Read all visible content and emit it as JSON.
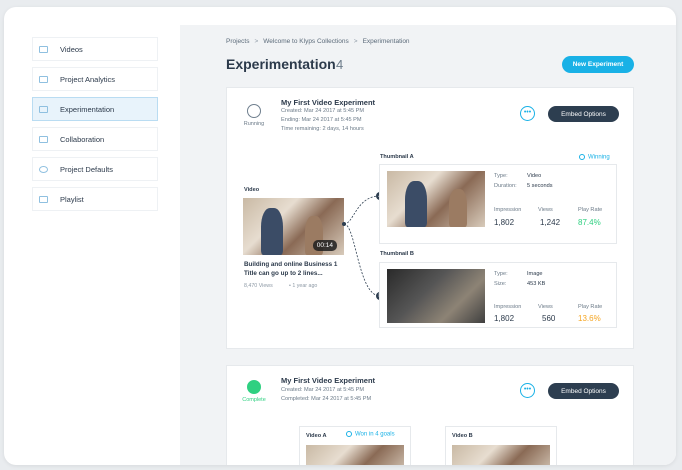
{
  "sidebar": {
    "items": [
      {
        "label": "Videos",
        "icon": "video-icon"
      },
      {
        "label": "Project Analytics",
        "icon": "analytics-icon"
      },
      {
        "label": "Experimentation",
        "icon": "experiment-icon",
        "active": true
      },
      {
        "label": "Collaboration",
        "icon": "collaboration-icon"
      },
      {
        "label": "Project Defaults",
        "icon": "gear-icon"
      },
      {
        "label": "Playlist",
        "icon": "playlist-icon"
      }
    ]
  },
  "breadcrumb": [
    "Projects",
    "Welcome to Klyps Collections",
    "Experimentation"
  ],
  "page": {
    "title": "Experimentation",
    "count": "4",
    "new_button": "New Experiment"
  },
  "experiment1": {
    "status": "Running",
    "title": "My First Video Experiment",
    "created": "Created: Mar 24 2017 at 5:45 PM",
    "ending": "Ending: Mar 24 2017 at 5:45 PM",
    "remaining": "Time remaining: 2 days, 14 hours",
    "more_label": "•••",
    "embed_label": "Embed Options",
    "video_label": "Video",
    "timecode": "00:14",
    "video_title_1": "Building and online Business 1",
    "video_title_2": "Title can go up to 2 lines...",
    "views": "8,470 Views",
    "age": "1 year ago",
    "thumbA": {
      "label": "Thumbnail A",
      "letter": "A",
      "winning": "Winning",
      "type_key": "Type:",
      "type_val": "Video",
      "dur_key": "Duration:",
      "dur_val": "5 seconds",
      "h_impr": "Impression",
      "h_views": "Views",
      "h_rate": "Play Rate",
      "impr": "1,802",
      "views": "1,242",
      "rate": "87.4%"
    },
    "thumbB": {
      "label": "Thumbnail B",
      "letter": "B",
      "type_key": "Type:",
      "type_val": "Image",
      "size_key": "Size:",
      "size_val": "453 KB",
      "h_impr": "Impression",
      "h_views": "Views",
      "h_rate": "Play Rate",
      "impr": "1,802",
      "views": "560",
      "rate": "13.6%"
    }
  },
  "experiment2": {
    "status": "Complete",
    "title": "My First Video Experiment",
    "created": "Created: Mar 24 2017 at 5:45 PM",
    "completed": "Completed: Mar 24 2017 at 5:45 PM",
    "more_label": "•••",
    "embed_label": "Embed Options",
    "videoA": "Video A",
    "win": "Won in 4 goals",
    "videoB": "Video B"
  },
  "colors": {
    "accent": "#19b1e6",
    "dark_button": "#2d3e50",
    "green": "#2fd081",
    "orange": "#f5a623"
  }
}
